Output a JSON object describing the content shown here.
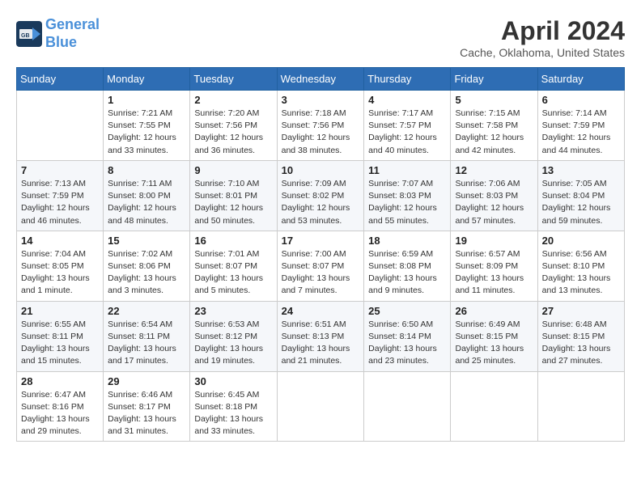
{
  "header": {
    "logo_line1": "General",
    "logo_line2": "Blue",
    "month_year": "April 2024",
    "location": "Cache, Oklahoma, United States"
  },
  "weekdays": [
    "Sunday",
    "Monday",
    "Tuesday",
    "Wednesday",
    "Thursday",
    "Friday",
    "Saturday"
  ],
  "weeks": [
    [
      {
        "day": "",
        "sunrise": "",
        "sunset": "",
        "daylight": ""
      },
      {
        "day": "1",
        "sunrise": "Sunrise: 7:21 AM",
        "sunset": "Sunset: 7:55 PM",
        "daylight": "Daylight: 12 hours and 33 minutes."
      },
      {
        "day": "2",
        "sunrise": "Sunrise: 7:20 AM",
        "sunset": "Sunset: 7:56 PM",
        "daylight": "Daylight: 12 hours and 36 minutes."
      },
      {
        "day": "3",
        "sunrise": "Sunrise: 7:18 AM",
        "sunset": "Sunset: 7:56 PM",
        "daylight": "Daylight: 12 hours and 38 minutes."
      },
      {
        "day": "4",
        "sunrise": "Sunrise: 7:17 AM",
        "sunset": "Sunset: 7:57 PM",
        "daylight": "Daylight: 12 hours and 40 minutes."
      },
      {
        "day": "5",
        "sunrise": "Sunrise: 7:15 AM",
        "sunset": "Sunset: 7:58 PM",
        "daylight": "Daylight: 12 hours and 42 minutes."
      },
      {
        "day": "6",
        "sunrise": "Sunrise: 7:14 AM",
        "sunset": "Sunset: 7:59 PM",
        "daylight": "Daylight: 12 hours and 44 minutes."
      }
    ],
    [
      {
        "day": "7",
        "sunrise": "Sunrise: 7:13 AM",
        "sunset": "Sunset: 7:59 PM",
        "daylight": "Daylight: 12 hours and 46 minutes."
      },
      {
        "day": "8",
        "sunrise": "Sunrise: 7:11 AM",
        "sunset": "Sunset: 8:00 PM",
        "daylight": "Daylight: 12 hours and 48 minutes."
      },
      {
        "day": "9",
        "sunrise": "Sunrise: 7:10 AM",
        "sunset": "Sunset: 8:01 PM",
        "daylight": "Daylight: 12 hours and 50 minutes."
      },
      {
        "day": "10",
        "sunrise": "Sunrise: 7:09 AM",
        "sunset": "Sunset: 8:02 PM",
        "daylight": "Daylight: 12 hours and 53 minutes."
      },
      {
        "day": "11",
        "sunrise": "Sunrise: 7:07 AM",
        "sunset": "Sunset: 8:03 PM",
        "daylight": "Daylight: 12 hours and 55 minutes."
      },
      {
        "day": "12",
        "sunrise": "Sunrise: 7:06 AM",
        "sunset": "Sunset: 8:03 PM",
        "daylight": "Daylight: 12 hours and 57 minutes."
      },
      {
        "day": "13",
        "sunrise": "Sunrise: 7:05 AM",
        "sunset": "Sunset: 8:04 PM",
        "daylight": "Daylight: 12 hours and 59 minutes."
      }
    ],
    [
      {
        "day": "14",
        "sunrise": "Sunrise: 7:04 AM",
        "sunset": "Sunset: 8:05 PM",
        "daylight": "Daylight: 13 hours and 1 minute."
      },
      {
        "day": "15",
        "sunrise": "Sunrise: 7:02 AM",
        "sunset": "Sunset: 8:06 PM",
        "daylight": "Daylight: 13 hours and 3 minutes."
      },
      {
        "day": "16",
        "sunrise": "Sunrise: 7:01 AM",
        "sunset": "Sunset: 8:07 PM",
        "daylight": "Daylight: 13 hours and 5 minutes."
      },
      {
        "day": "17",
        "sunrise": "Sunrise: 7:00 AM",
        "sunset": "Sunset: 8:07 PM",
        "daylight": "Daylight: 13 hours and 7 minutes."
      },
      {
        "day": "18",
        "sunrise": "Sunrise: 6:59 AM",
        "sunset": "Sunset: 8:08 PM",
        "daylight": "Daylight: 13 hours and 9 minutes."
      },
      {
        "day": "19",
        "sunrise": "Sunrise: 6:57 AM",
        "sunset": "Sunset: 8:09 PM",
        "daylight": "Daylight: 13 hours and 11 minutes."
      },
      {
        "day": "20",
        "sunrise": "Sunrise: 6:56 AM",
        "sunset": "Sunset: 8:10 PM",
        "daylight": "Daylight: 13 hours and 13 minutes."
      }
    ],
    [
      {
        "day": "21",
        "sunrise": "Sunrise: 6:55 AM",
        "sunset": "Sunset: 8:11 PM",
        "daylight": "Daylight: 13 hours and 15 minutes."
      },
      {
        "day": "22",
        "sunrise": "Sunrise: 6:54 AM",
        "sunset": "Sunset: 8:11 PM",
        "daylight": "Daylight: 13 hours and 17 minutes."
      },
      {
        "day": "23",
        "sunrise": "Sunrise: 6:53 AM",
        "sunset": "Sunset: 8:12 PM",
        "daylight": "Daylight: 13 hours and 19 minutes."
      },
      {
        "day": "24",
        "sunrise": "Sunrise: 6:51 AM",
        "sunset": "Sunset: 8:13 PM",
        "daylight": "Daylight: 13 hours and 21 minutes."
      },
      {
        "day": "25",
        "sunrise": "Sunrise: 6:50 AM",
        "sunset": "Sunset: 8:14 PM",
        "daylight": "Daylight: 13 hours and 23 minutes."
      },
      {
        "day": "26",
        "sunrise": "Sunrise: 6:49 AM",
        "sunset": "Sunset: 8:15 PM",
        "daylight": "Daylight: 13 hours and 25 minutes."
      },
      {
        "day": "27",
        "sunrise": "Sunrise: 6:48 AM",
        "sunset": "Sunset: 8:15 PM",
        "daylight": "Daylight: 13 hours and 27 minutes."
      }
    ],
    [
      {
        "day": "28",
        "sunrise": "Sunrise: 6:47 AM",
        "sunset": "Sunset: 8:16 PM",
        "daylight": "Daylight: 13 hours and 29 minutes."
      },
      {
        "day": "29",
        "sunrise": "Sunrise: 6:46 AM",
        "sunset": "Sunset: 8:17 PM",
        "daylight": "Daylight: 13 hours and 31 minutes."
      },
      {
        "day": "30",
        "sunrise": "Sunrise: 6:45 AM",
        "sunset": "Sunset: 8:18 PM",
        "daylight": "Daylight: 13 hours and 33 minutes."
      },
      {
        "day": "",
        "sunrise": "",
        "sunset": "",
        "daylight": ""
      },
      {
        "day": "",
        "sunrise": "",
        "sunset": "",
        "daylight": ""
      },
      {
        "day": "",
        "sunrise": "",
        "sunset": "",
        "daylight": ""
      },
      {
        "day": "",
        "sunrise": "",
        "sunset": "",
        "daylight": ""
      }
    ]
  ]
}
